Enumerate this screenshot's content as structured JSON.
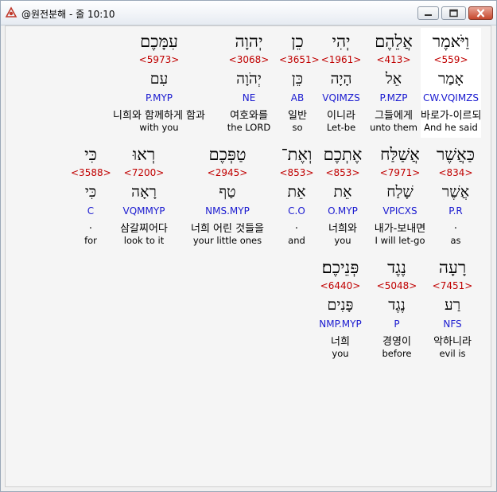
{
  "window": {
    "title": "@원전분해 - 줄 10:10",
    "icon": "app-logo-icon",
    "buttons": [
      "minimize-icon",
      "maximize-icon",
      "close-icon"
    ]
  },
  "colors": {
    "strong_number": "#c00000",
    "parsing": "#1a1ad0",
    "highlight": "#ffffff"
  },
  "rows": [
    [
      {
        "hebrew": "וַיֹּאמֶר",
        "strong": "<559>",
        "root": "אָמַר",
        "parsing": "CW.VQIMZS",
        "korean": "바로가-이르되",
        "english": "And he said",
        "highlight": true
      },
      {
        "hebrew": "אֲלֵהֶם",
        "strong": "<413>",
        "root": "אֵל",
        "parsing": "P.MZP",
        "korean": "그들에게",
        "english": "unto them"
      },
      {
        "hebrew": "יְהִי",
        "strong": "<1961>",
        "root": "הָיָה",
        "parsing": "VQIMZS",
        "korean": "이니라",
        "english": "Let-be"
      },
      {
        "hebrew": "כֵן",
        "strong": "<3651>",
        "root": "כֵּן",
        "parsing": "AB",
        "korean": "일반",
        "english": "so"
      },
      {
        "hebrew": "יְהוָה",
        "strong": "<3068>",
        "root": "יְהֹוָה",
        "parsing": "NE",
        "korean": "여호와를",
        "english": "the LORD"
      },
      {
        "hebrew": "עִמָּכֶם",
        "strong": "<5973>",
        "root": "עִם",
        "parsing": "P.MYP",
        "korean": "니희와 함께하게 함과",
        "english": "with you"
      }
    ],
    [
      {
        "hebrew": "כַּאֲשֶׁר",
        "strong": "<834>",
        "root": "אֲשֶׁר",
        "parsing": "P.R",
        "korean": ".",
        "english": "as"
      },
      {
        "hebrew": "אֲשַׁלַּח",
        "strong": "<7971>",
        "root": "שָׁלַח",
        "parsing": "VPICXS",
        "korean": "내가-보내면",
        "english": "I will let-go"
      },
      {
        "hebrew": "אֶתְכֶם",
        "strong": "<853>",
        "root": "אֵת",
        "parsing": "O.MYP",
        "korean": "너희와",
        "english": "you"
      },
      {
        "hebrew": "וְאֶת־",
        "strong": "<853>",
        "root": "אֵת",
        "parsing": "C.O",
        "korean": ".",
        "english": "and"
      },
      {
        "hebrew": "טַפְּכֶם",
        "strong": "<2945>",
        "root": "טַף",
        "parsing": "NMS.MYP",
        "korean": "너희 어린 것들을",
        "english": "your little ones"
      },
      {
        "hebrew": "רְאוּ",
        "strong": "<7200>",
        "root": "רָאָה",
        "parsing": "VQMMYP",
        "korean": "삼갈찌어다",
        "english": "look to it"
      },
      {
        "hebrew": "כִּי",
        "strong": "<3588>",
        "root": "כִּי",
        "parsing": "C",
        "korean": ".",
        "english": "for"
      }
    ],
    [
      {
        "hebrew": "רָעָה",
        "strong": "<7451>",
        "root": "רַע",
        "parsing": "NFS",
        "korean": "악하니라",
        "english": "evil is"
      },
      {
        "hebrew": "נֶגֶד",
        "strong": "<5048>",
        "root": "נֶגֶד",
        "parsing": "P",
        "korean": "경영이",
        "english": "before"
      },
      {
        "hebrew": "פְּנֵיכֶם׃",
        "strong": "<6440>",
        "root": "פָּנִים",
        "parsing": "NMP.MYP",
        "korean": "너희",
        "english": "you"
      }
    ]
  ]
}
